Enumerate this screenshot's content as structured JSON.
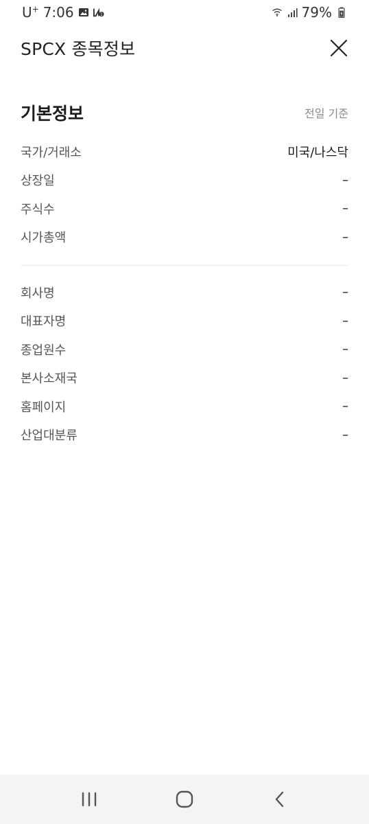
{
  "status_bar": {
    "carrier": "U",
    "carrier_sup": "+",
    "time": "7:06",
    "battery": "79%"
  },
  "header": {
    "title": "SPCX 종목정보"
  },
  "section": {
    "title": "기본정보",
    "note": "전일 기준"
  },
  "basic_rows": [
    {
      "label": "국가/거래소",
      "value": "미국/나스닥"
    },
    {
      "label": "상장일",
      "value": "–"
    },
    {
      "label": "주식수",
      "value": "–"
    },
    {
      "label": "시가총액",
      "value": "–"
    }
  ],
  "company_rows": [
    {
      "label": "회사명",
      "value": "–"
    },
    {
      "label": "대표자명",
      "value": "–"
    },
    {
      "label": "종업원수",
      "value": "–"
    },
    {
      "label": "본사소재국",
      "value": "–"
    },
    {
      "label": "홈페이지",
      "value": "–"
    },
    {
      "label": "산업대분류",
      "value": "–"
    }
  ]
}
